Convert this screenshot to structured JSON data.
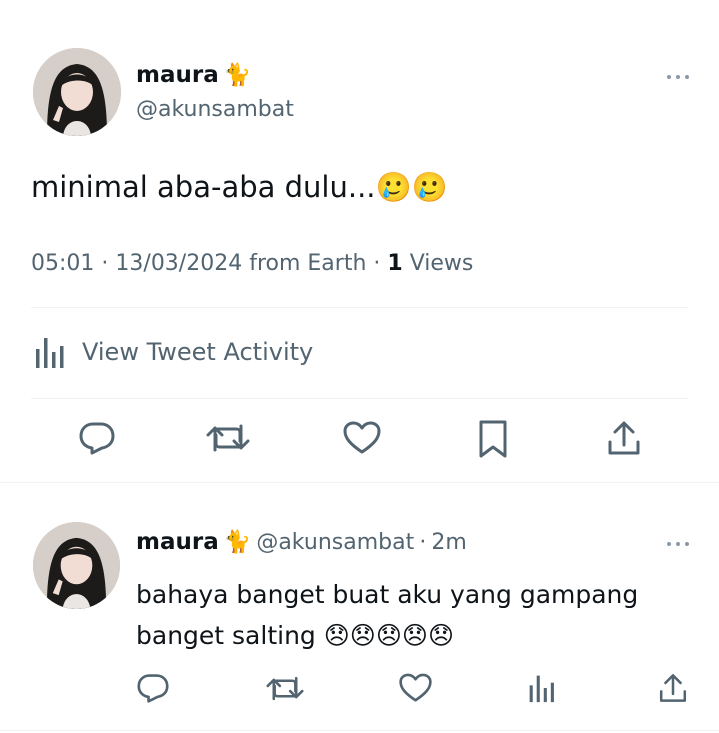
{
  "tweet": {
    "name": "maura",
    "name_emoji": "🐈",
    "handle": "@akunsambat",
    "text": "minimal aba-aba dulu...🥲🥲",
    "time": "05:01",
    "date": "13/03/2024",
    "source": "from Earth",
    "views_count": "1",
    "views_label": "Views",
    "activity_label": "View Tweet Activity",
    "more_icon": "more-horizontal-icon",
    "actions": [
      "reply-icon",
      "retweet-icon",
      "like-icon",
      "bookmark-icon",
      "share-icon"
    ]
  },
  "reply": {
    "name": "maura",
    "name_emoji": "🐈",
    "handle": "@akunsambat",
    "time_ago": "2m",
    "text": "bahaya banget buat aku yang gampang banget salting 😞😞😞😞😞",
    "actions": [
      "reply-icon",
      "retweet-icon",
      "like-icon",
      "analytics-icon",
      "share-icon"
    ]
  },
  "colors": {
    "text": "#0f1419",
    "secondary": "#536471",
    "divider": "#eff3f4",
    "icon": "#536471"
  }
}
